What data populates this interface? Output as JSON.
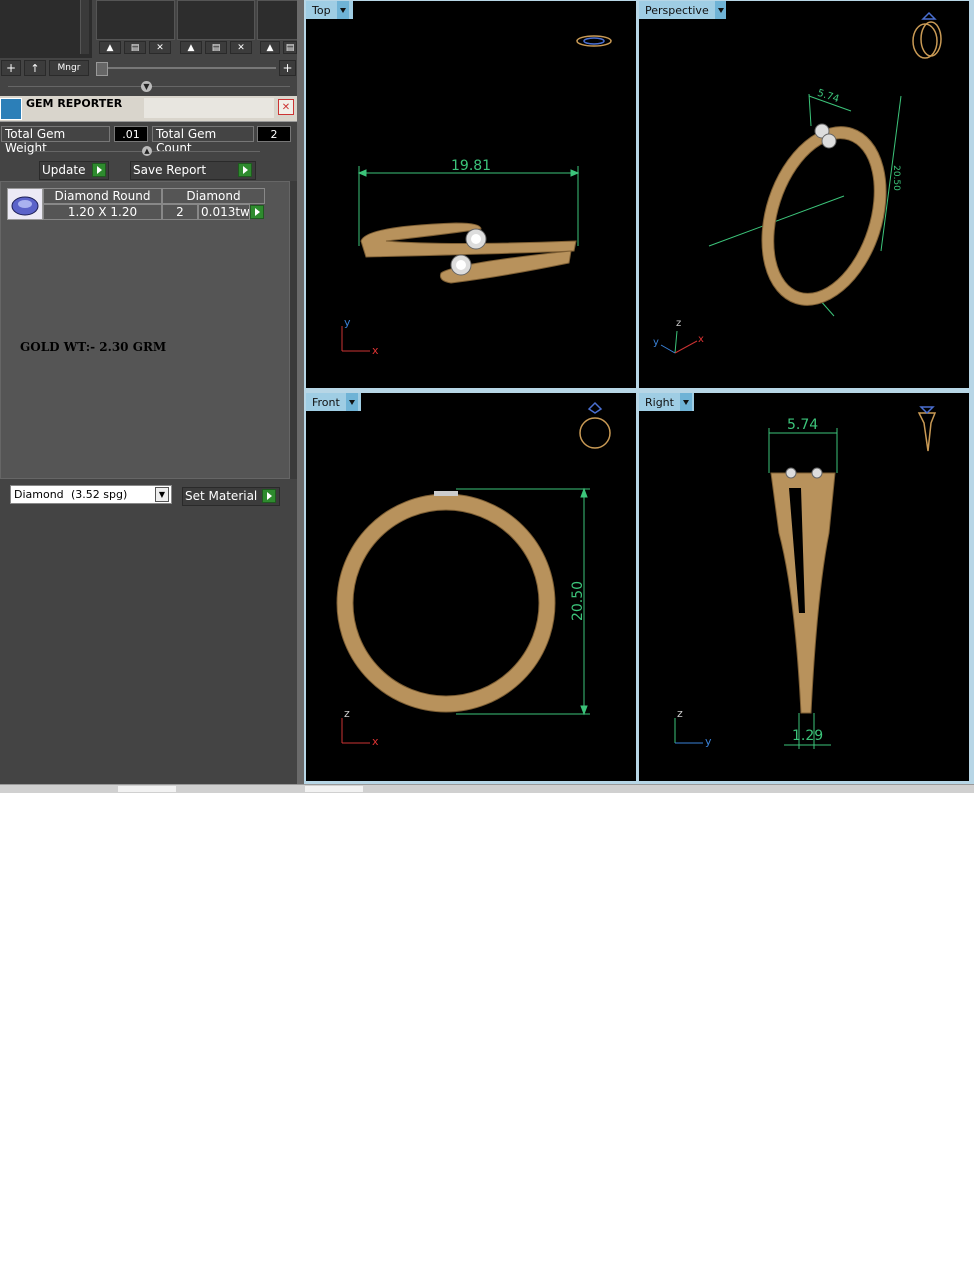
{
  "toolbar": {
    "add_label": "+",
    "up_label": "↑",
    "mngr_label": "Mngr",
    "plus_label": "+"
  },
  "gem_reporter": {
    "title": "GEM REPORTER",
    "total_weight_label": "Total Gem Weight",
    "total_weight_value": ".01",
    "total_count_label": "Total Gem Count",
    "total_count_value": "2",
    "update_label": "Update",
    "save_report_label": "Save Report",
    "table": {
      "headers": [
        "Diamond Round",
        "Diamond"
      ],
      "row": {
        "size": "1.20 X 1.20",
        "count": "2",
        "weight": "0.013tw"
      }
    },
    "note": "GOLD WT:- 2.30 GRM",
    "material_select": {
      "name": "Diamond",
      "spg": "(3.52 spg)"
    },
    "set_material_label": "Set Material"
  },
  "viewports": {
    "top": {
      "label": "Top",
      "dimension": "19.81"
    },
    "perspective": {
      "label": "Perspective",
      "dimension_width": "5.74",
      "dimension_height": "20.50"
    },
    "front": {
      "label": "Front",
      "dimension": "20.50"
    },
    "right": {
      "label": "Right",
      "dimension_width": "5.74",
      "dimension_thickness": "1.29"
    }
  },
  "axes": {
    "x": "x",
    "y": "y",
    "z": "z"
  },
  "colors": {
    "ring_gold": "#b8925c",
    "dim_line": "#3cc47a",
    "tab_blue": "#9fcde4",
    "panel_bg": "#444444"
  }
}
